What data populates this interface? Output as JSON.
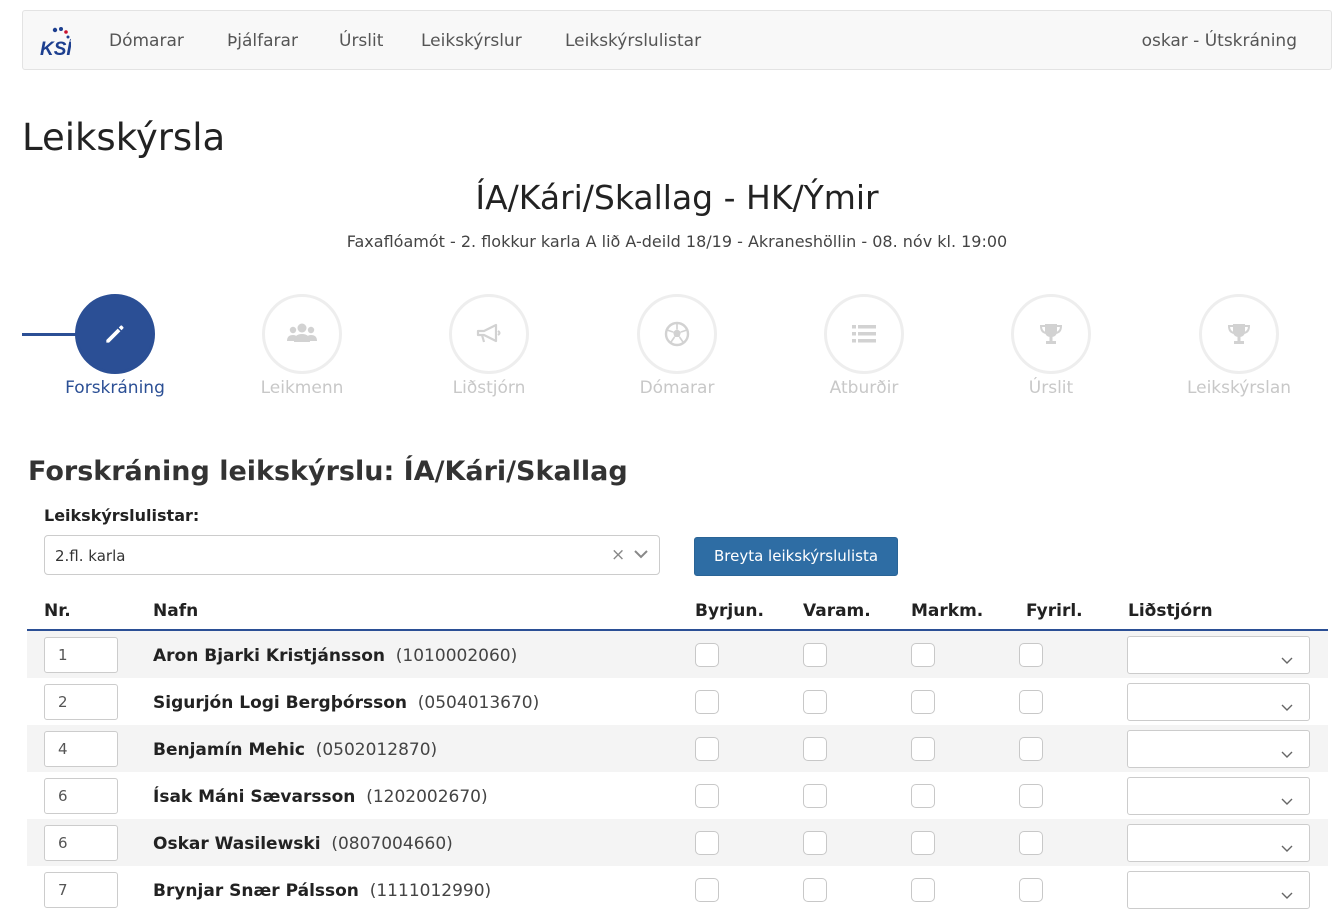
{
  "nav": {
    "items": [
      "Dómarar",
      "Þjálfarar",
      "Úrslit",
      "Leikskýrslur",
      "Leikskýrslulistar"
    ],
    "user": "oskar - Útskráning",
    "logo_text": "KSÍ"
  },
  "page_title": "Leikskýrsla",
  "match": {
    "title": "ÍA/Kári/Skallag - HK/Ýmir",
    "subtitle": "Faxaflóamót - 2. flokkur karla A lið A-deild 18/19 - Akraneshöllin - 08. nóv kl. 19:00"
  },
  "steps": [
    {
      "label": "Forskráning",
      "icon": "pencil-icon",
      "active": true
    },
    {
      "label": "Leikmenn",
      "icon": "users-icon",
      "active": false
    },
    {
      "label": "Liðstjórn",
      "icon": "bullhorn-icon",
      "active": false
    },
    {
      "label": "Dómarar",
      "icon": "soccer-ball-icon",
      "active": false
    },
    {
      "label": "Atburðir",
      "icon": "list-icon",
      "active": false
    },
    {
      "label": "Úrslit",
      "icon": "trophy-icon",
      "active": false
    },
    {
      "label": "Leikskýrslan",
      "icon": "trophy-icon",
      "active": false
    }
  ],
  "section": {
    "title": "Forskráning leikskýrslu: ÍA/Kári/Skallag",
    "list_label": "Leikskýrslulistar:",
    "list_value": "2.fl. karla",
    "change_button": "Breyta leikskýrslulista"
  },
  "table": {
    "headers": {
      "nr": "Nr.",
      "name": "Nafn",
      "start": "Byrjun.",
      "sub": "Varam.",
      "keeper": "Markm.",
      "captain": "Fyrirl.",
      "staff": "Liðstjórn"
    },
    "rows": [
      {
        "nr": "1",
        "name": "Aron Bjarki Kristjánsson",
        "kt": "(1010002060)"
      },
      {
        "nr": "2",
        "name": "Sigurjón Logi Bergþórsson",
        "kt": "(0504013670)"
      },
      {
        "nr": "4",
        "name": "Benjamín Mehic",
        "kt": "(0502012870)"
      },
      {
        "nr": "6",
        "name": "Ísak Máni Sævarsson",
        "kt": "(1202002670)"
      },
      {
        "nr": "6",
        "name": "Oskar Wasilewski",
        "kt": "(0807004660)"
      },
      {
        "nr": "7",
        "name": "Brynjar Snær Pálsson",
        "kt": "(1111012990)"
      }
    ]
  },
  "colors": {
    "primary": "#2b4f95",
    "button": "#2e6da4",
    "muted": "#c8c8c8"
  }
}
